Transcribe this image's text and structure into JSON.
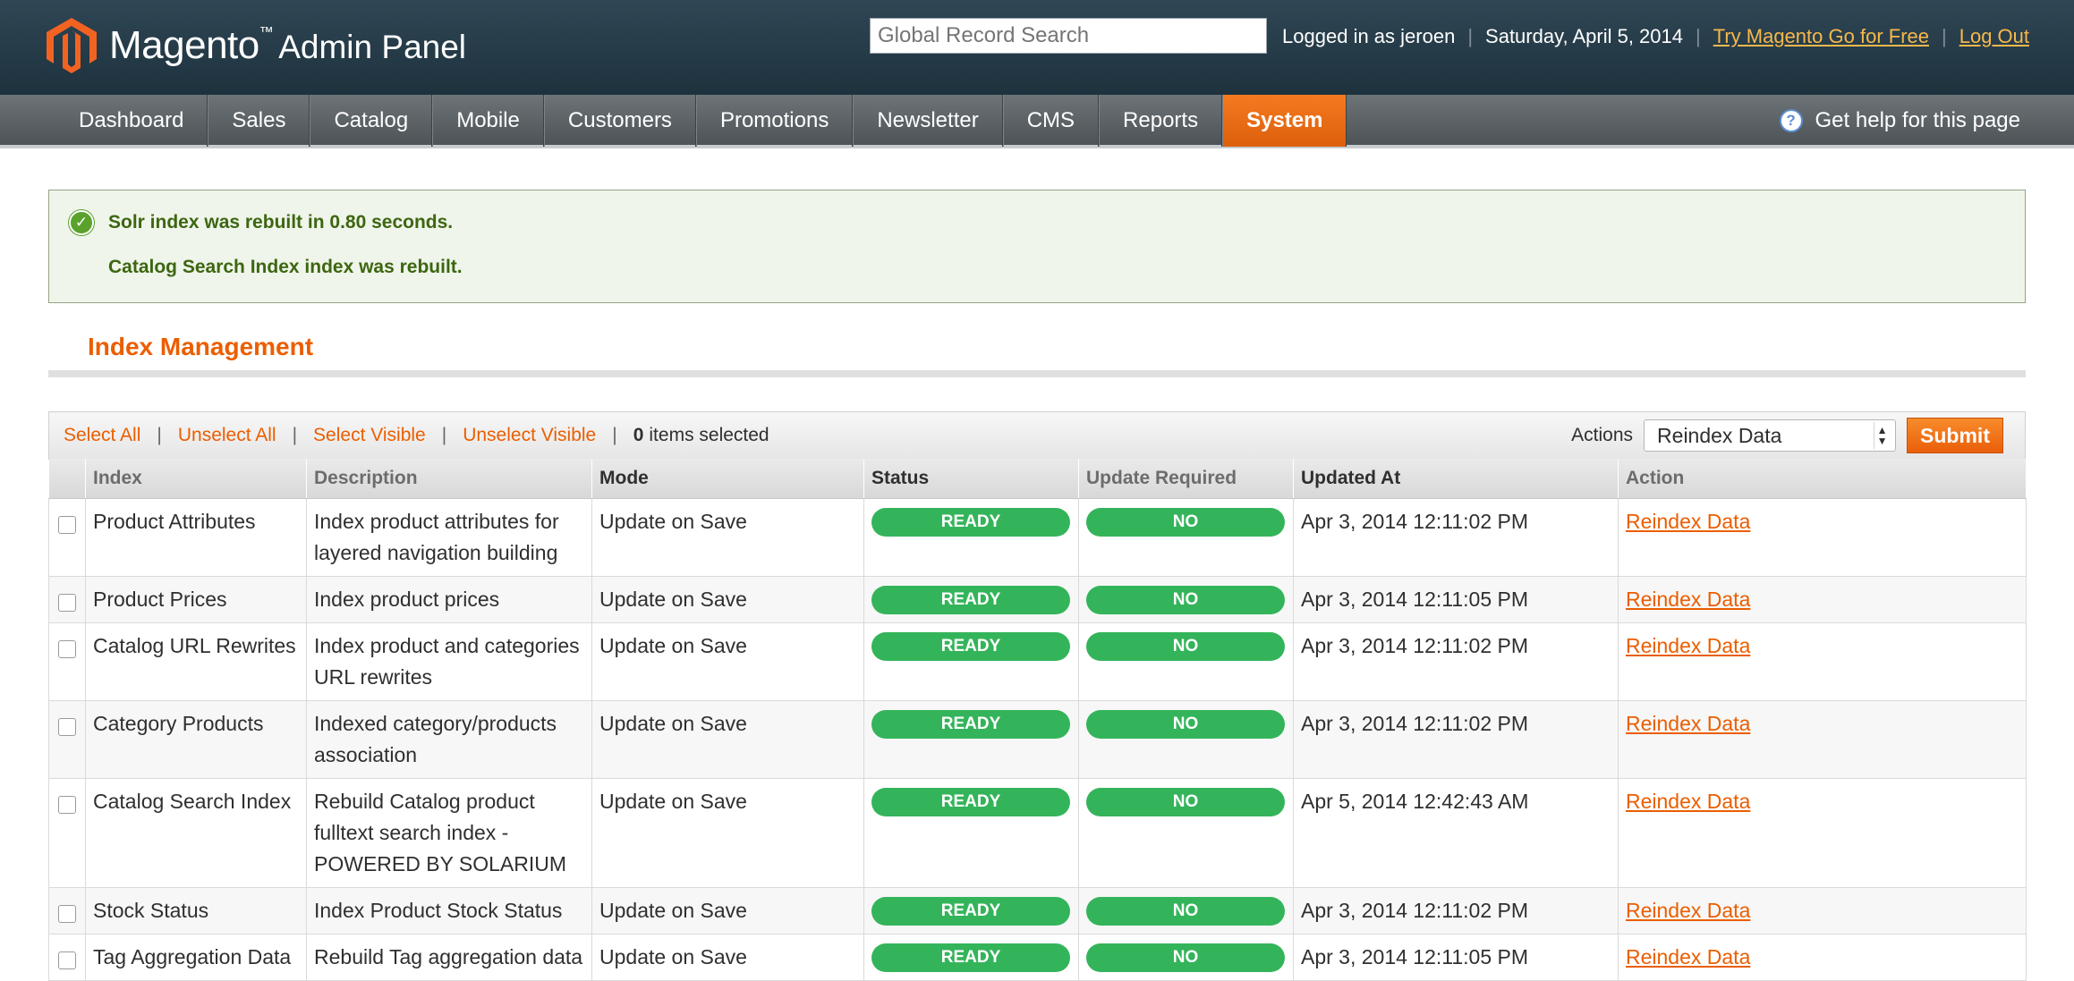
{
  "header": {
    "logo_text": "Magento",
    "logo_tm": "™",
    "logo_sub": "Admin Panel",
    "search_placeholder": "Global Record Search",
    "logged_in": "Logged in as jeroen",
    "date": "Saturday, April 5, 2014",
    "try_link": "Try Magento Go for Free",
    "logout_link": "Log Out"
  },
  "nav": {
    "items": [
      "Dashboard",
      "Sales",
      "Catalog",
      "Mobile",
      "Customers",
      "Promotions",
      "Newsletter",
      "CMS",
      "Reports",
      "System"
    ],
    "active": "System",
    "help": "Get help for this page"
  },
  "messages": {
    "line1": "Solr index was rebuilt in 0.80 seconds.",
    "line2": "Catalog Search Index index was rebuilt."
  },
  "page_title": "Index Management",
  "massaction": {
    "select_all": "Select All",
    "unselect_all": "Unselect All",
    "select_visible": "Select Visible",
    "unselect_visible": "Unselect Visible",
    "count": "0",
    "count_suffix": "items selected",
    "actions_label": "Actions",
    "selected_action": "Reindex Data",
    "submit": "Submit"
  },
  "grid": {
    "columns": [
      "Index",
      "Description",
      "Mode",
      "Status",
      "Update Required",
      "Updated At",
      "Action"
    ],
    "rows": [
      {
        "index": "Product Attributes",
        "description": "Index product attributes for layered navigation building",
        "mode": "Update on Save",
        "status": "READY",
        "update_required": "NO",
        "updated_at": "Apr 3, 2014 12:11:02 PM",
        "action": "Reindex Data"
      },
      {
        "index": "Product Prices",
        "description": "Index product prices",
        "mode": "Update on Save",
        "status": "READY",
        "update_required": "NO",
        "updated_at": "Apr 3, 2014 12:11:05 PM",
        "action": "Reindex Data"
      },
      {
        "index": "Catalog URL Rewrites",
        "description": "Index product and categories URL rewrites",
        "mode": "Update on Save",
        "status": "READY",
        "update_required": "NO",
        "updated_at": "Apr 3, 2014 12:11:02 PM",
        "action": "Reindex Data"
      },
      {
        "index": "Category Products",
        "description": "Indexed category/products association",
        "mode": "Update on Save",
        "status": "READY",
        "update_required": "NO",
        "updated_at": "Apr 3, 2014 12:11:02 PM",
        "action": "Reindex Data"
      },
      {
        "index": "Catalog Search Index",
        "description": "Rebuild Catalog product fulltext search index - POWERED BY SOLARIUM",
        "mode": "Update on Save",
        "status": "READY",
        "update_required": "NO",
        "updated_at": "Apr 5, 2014 12:42:43 AM",
        "action": "Reindex Data"
      },
      {
        "index": "Stock Status",
        "description": "Index Product Stock Status",
        "mode": "Update on Save",
        "status": "READY",
        "update_required": "NO",
        "updated_at": "Apr 3, 2014 12:11:02 PM",
        "action": "Reindex Data"
      },
      {
        "index": "Tag Aggregation Data",
        "description": "Rebuild Tag aggregation data",
        "mode": "Update on Save",
        "status": "READY",
        "update_required": "NO",
        "updated_at": "Apr 3, 2014 12:11:05 PM",
        "action": "Reindex Data"
      }
    ]
  },
  "colors": {
    "brand_orange": "#eb5e00",
    "status_green": "#34b45a",
    "header_dark": "#1e323e",
    "message_green": "#3d6611"
  },
  "icons": {
    "logo": "magento-logo-icon",
    "help": "help-icon",
    "success": "success-check-icon",
    "select_arrows": "select-arrows-icon"
  }
}
